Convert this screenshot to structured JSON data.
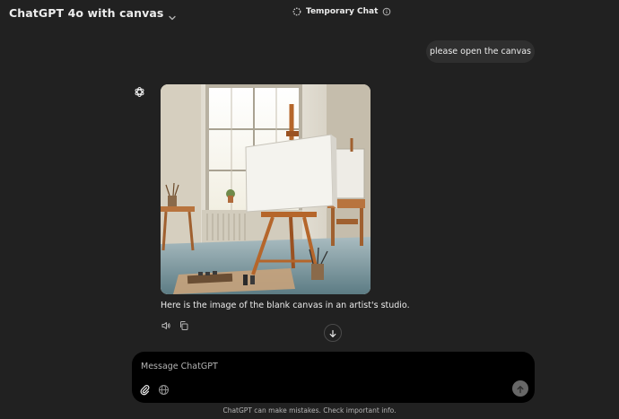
{
  "header": {
    "model_title": "ChatGPT 4o with canvas",
    "temporary_chat_label": "Temporary Chat"
  },
  "conversation": {
    "user_message": "please open the canvas",
    "assistant_text": "Here is the image of the blank canvas in an artist's studio."
  },
  "composer": {
    "placeholder": "Message ChatGPT"
  },
  "footer": {
    "note": "ChatGPT can make mistakes. Check important info."
  },
  "icons": {
    "model_chevron": "chevron-down-icon",
    "temporary_chat": "dashed-circle-icon",
    "info": "info-icon",
    "assistant_avatar": "openai-logo-icon",
    "read_aloud": "speaker-icon",
    "copy": "copy-icon",
    "scroll_down": "arrow-down-icon",
    "attach": "paperclip-icon",
    "web_search": "globe-icon",
    "send": "arrow-up-icon"
  },
  "colors": {
    "background": "#212121",
    "bubble": "#2f2f2f",
    "composer": "#000000",
    "text": "#ececec",
    "muted": "#b4b4b4",
    "send_disabled": "#676767"
  }
}
